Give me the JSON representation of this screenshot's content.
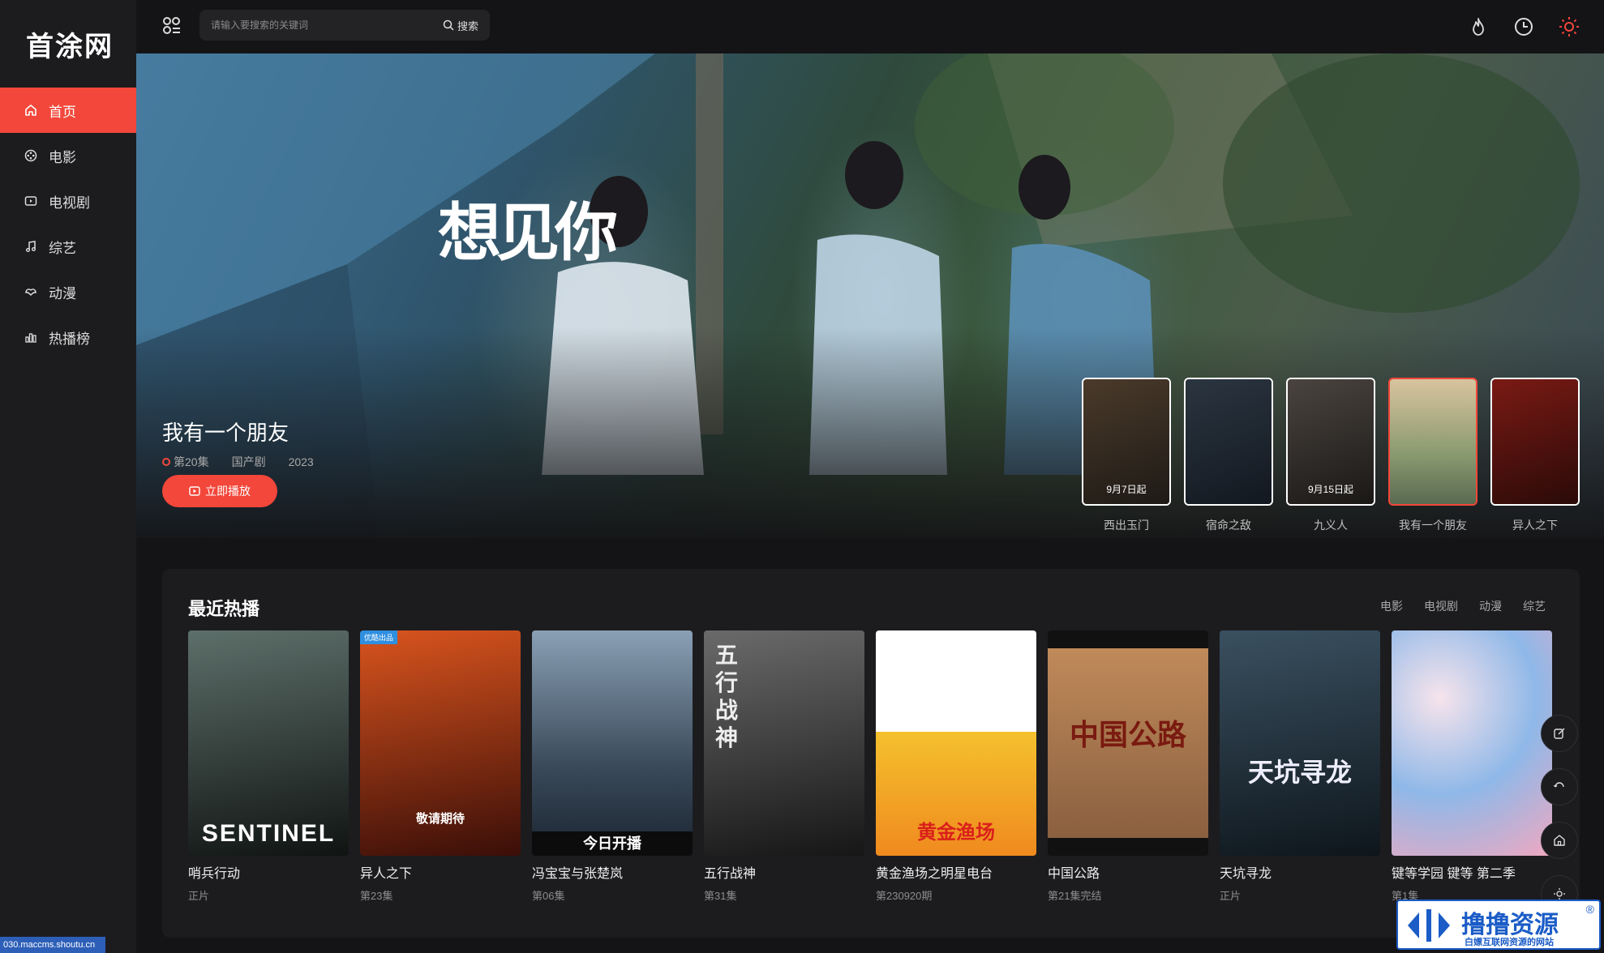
{
  "site": {
    "logo": "首涂网"
  },
  "sidebar": {
    "items": [
      {
        "label": "首页",
        "icon": "home-icon",
        "active": true
      },
      {
        "label": "电影",
        "icon": "film-reel-icon",
        "active": false
      },
      {
        "label": "电视剧",
        "icon": "tv-icon",
        "active": false
      },
      {
        "label": "综艺",
        "icon": "music-note-icon",
        "active": false
      },
      {
        "label": "动漫",
        "icon": "anime-icon",
        "active": false
      },
      {
        "label": "热播榜",
        "icon": "chart-icon",
        "active": false
      }
    ]
  },
  "header": {
    "search_placeholder": "请输入要搜索的关键词",
    "search_button": "搜索",
    "icons": [
      "fire-icon",
      "clock-icon",
      "sun-icon"
    ]
  },
  "hero": {
    "art_text": "想见你",
    "title": "我有一个朋友",
    "episode": "第20集",
    "genre": "国产剧",
    "year": "2023",
    "play_label": "立即播放",
    "thumbs": [
      {
        "label": "西出玉门",
        "poster_text": "9月7日起",
        "colors": [
          "#4a3a2a",
          "#1e1a16"
        ]
      },
      {
        "label": "宿命之敌",
        "poster_text": "",
        "colors": [
          "#2b3540",
          "#121820"
        ]
      },
      {
        "label": "九义人",
        "poster_text": "9月15日起",
        "colors": [
          "#4a4440",
          "#1a1816"
        ]
      },
      {
        "label": "我有一个朋友",
        "poster_text": "",
        "colors": [
          "#c9b08a",
          "#5a6a50"
        ]
      },
      {
        "label": "异人之下",
        "poster_text": "",
        "colors": [
          "#7a1a14",
          "#2a0a08"
        ]
      }
    ]
  },
  "recent": {
    "title": "最近热播",
    "tabs": [
      "电影",
      "电视剧",
      "动漫",
      "综艺"
    ],
    "cards": [
      {
        "title": "哨兵行动",
        "sub": "正片",
        "poster_text": "SENTINEL",
        "colors": [
          "#5d6f6a",
          "#101412"
        ]
      },
      {
        "title": "异人之下",
        "sub": "第23集",
        "poster_text": "敬请期待",
        "badge": "优酷出品",
        "colors": [
          "#d9541e",
          "#3a0e08"
        ]
      },
      {
        "title": "冯宝宝与张楚岚",
        "sub": "第06集",
        "poster_text": "今日开播",
        "colors": [
          "#8aa0b5",
          "#1a2430"
        ]
      },
      {
        "title": "五行战神",
        "sub": "第31集",
        "poster_text": "五行战神",
        "colors": [
          "#6a6a6a",
          "#161616"
        ]
      },
      {
        "title": "黄金渔场之明星电台",
        "sub": "第230920期",
        "poster_text": "黄金渔场",
        "colors": [
          "#f4c12e",
          "#f08a1e"
        ]
      },
      {
        "title": "中国公路",
        "sub": "第21集完结",
        "poster_text": "中国公路",
        "colors": [
          "#c08a5a",
          "#6a4a30"
        ]
      },
      {
        "title": "天坑寻龙",
        "sub": "正片",
        "poster_text": "天坑寻龙",
        "colors": [
          "#3a5060",
          "#0e161c"
        ]
      },
      {
        "title": "键等学园 键等 第二季",
        "sub": "第1集",
        "poster_text": "",
        "colors": [
          "#8fb8e8",
          "#f0a8c0"
        ]
      }
    ]
  },
  "float_buttons": [
    "edit-icon",
    "refresh-icon",
    "home-outline-icon",
    "sun-small-icon"
  ],
  "footer_url": "030.maccms.shoutu.cn",
  "watermark": {
    "main": "撸撸资源",
    "sub": "白嫖互联网资源的网站",
    "reg": "®"
  },
  "colors": {
    "accent": "#f2473a",
    "bg": "#141416",
    "panel": "#1c1c1f"
  }
}
